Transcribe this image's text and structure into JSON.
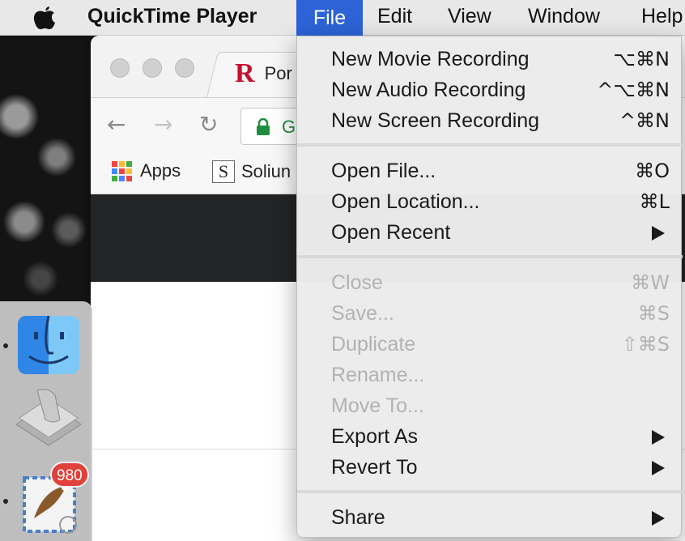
{
  "menubar": {
    "app_name": "QuickTime Player",
    "items": [
      "File",
      "Edit",
      "View",
      "Window",
      "Help"
    ],
    "active": "File"
  },
  "browser": {
    "tab_title": "Por",
    "tab_logo": "R",
    "url_text": "G",
    "bookmarks": [
      "Apps",
      "Soliun"
    ],
    "solium_icon_letter": "S"
  },
  "dock": {
    "apps": [
      "finder-icon",
      "script-editor-icon",
      "mail-icon"
    ],
    "mail_badge": "980"
  },
  "file_menu": {
    "groups": [
      [
        {
          "label": "New Movie Recording",
          "shortcut": "⌥⌘N",
          "enabled": true
        },
        {
          "label": "New Audio Recording",
          "shortcut": "^⌥⌘N",
          "enabled": true
        },
        {
          "label": "New Screen Recording",
          "shortcut": "^⌘N",
          "enabled": true
        }
      ],
      [
        {
          "label": "Open File...",
          "shortcut": "⌘O",
          "enabled": true
        },
        {
          "label": "Open Location...",
          "shortcut": "⌘L",
          "enabled": true
        },
        {
          "label": "Open Recent",
          "submenu": true,
          "enabled": true
        }
      ],
      [
        {
          "label": "Close",
          "shortcut": "⌘W",
          "enabled": false
        },
        {
          "label": "Save...",
          "shortcut": "⌘S",
          "enabled": false
        },
        {
          "label": "Duplicate",
          "shortcut": "⇧⌘S",
          "enabled": false
        },
        {
          "label": "Rename...",
          "enabled": false
        },
        {
          "label": "Move To...",
          "enabled": false
        },
        {
          "label": "Export As",
          "submenu": true,
          "enabled": true
        },
        {
          "label": "Revert To",
          "submenu": true,
          "enabled": true
        }
      ],
      [
        {
          "label": "Share",
          "submenu": true,
          "enabled": true
        }
      ]
    ]
  }
}
